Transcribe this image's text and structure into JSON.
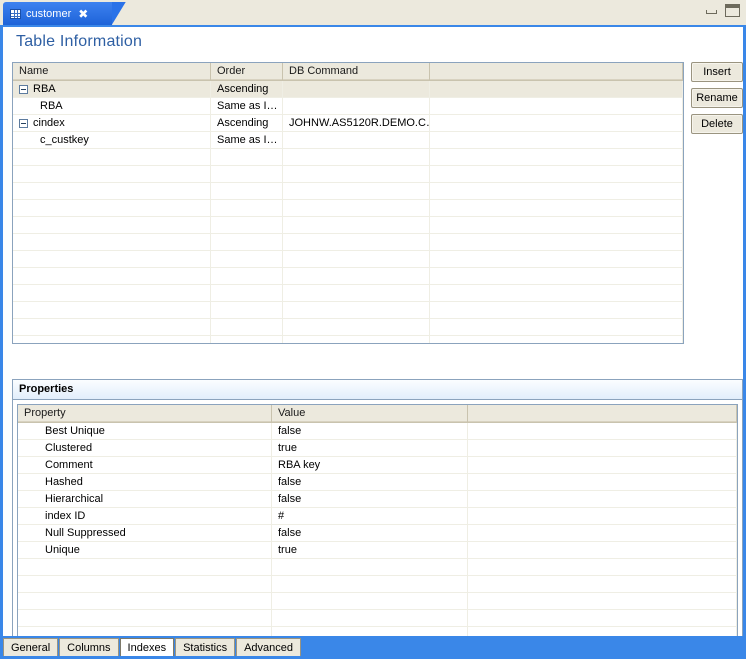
{
  "window": {
    "minimize_label": "minimize",
    "maximize_label": "maximize"
  },
  "tab": {
    "label": "customer",
    "close_label": "✖",
    "icon": "table-grid-icon"
  },
  "page": {
    "title": "Table Information"
  },
  "index_table": {
    "columns": [
      "Name",
      "Order",
      "DB Command",
      ""
    ],
    "rows": [
      {
        "name": "RBA",
        "expander": true,
        "indent": false,
        "order": "Ascending",
        "db_command": ""
      },
      {
        "name": "RBA",
        "expander": false,
        "indent": true,
        "order": "Same as I…",
        "db_command": ""
      },
      {
        "name": "cindex",
        "expander": true,
        "indent": false,
        "order": "Ascending",
        "db_command": "JOHNW.AS5120R.DEMO.C…"
      },
      {
        "name": "c_custkey",
        "expander": false,
        "indent": true,
        "order": "Same as I…",
        "db_command": ""
      }
    ],
    "empty_rows": 12
  },
  "buttons": {
    "insert": "Insert",
    "rename": "Rename",
    "delete": "Delete"
  },
  "properties": {
    "header": "Properties",
    "columns": [
      "Property",
      "Value",
      ""
    ],
    "rows": [
      {
        "property": "Best Unique",
        "value": "false"
      },
      {
        "property": "Clustered",
        "value": "true"
      },
      {
        "property": "Comment",
        "value": "RBA key"
      },
      {
        "property": "Hashed",
        "value": "false"
      },
      {
        "property": "Hierarchical",
        "value": "false"
      },
      {
        "property": "index ID",
        "value": "#"
      },
      {
        "property": "Null Suppressed",
        "value": "false"
      },
      {
        "property": "Unique",
        "value": "true"
      }
    ],
    "empty_rows": 6
  },
  "bottom_tabs": [
    {
      "label": "General",
      "active": false
    },
    {
      "label": "Columns",
      "active": false
    },
    {
      "label": "Indexes",
      "active": true
    },
    {
      "label": "Statistics",
      "active": false
    },
    {
      "label": "Advanced",
      "active": false
    }
  ],
  "colors": {
    "accent": "#3a87e8",
    "title": "#2e5fa3",
    "header_bg": "#ece9dd"
  }
}
